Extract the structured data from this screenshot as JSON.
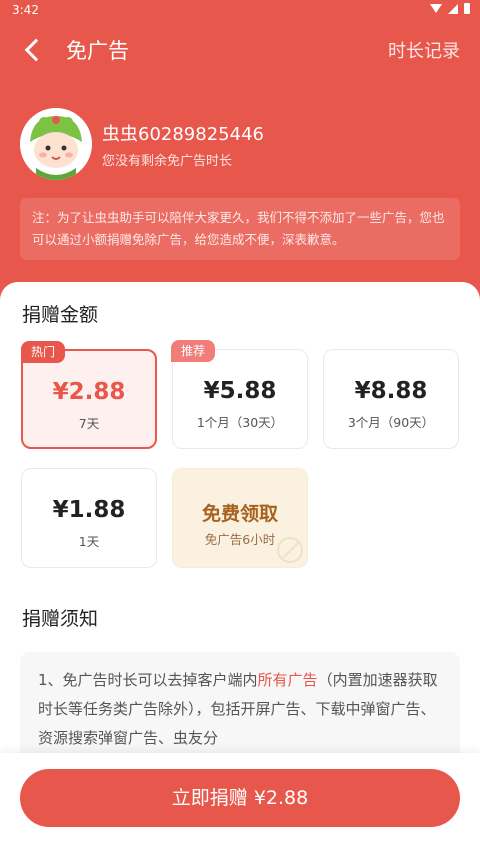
{
  "status_bar": {
    "time": "3:42",
    "icons": [
      "wifi-icon",
      "signal-icon",
      "battery-icon"
    ]
  },
  "header": {
    "back_icon": "chevron-left-icon",
    "title": "免广告",
    "record_link": "时长记录"
  },
  "user": {
    "name": "虫虫60289825446",
    "remaining_text": "您没有剩余免广告时长"
  },
  "notice": "注：为了让虫虫助手可以陪伴大家更久，我们不得不添加了一些广告，您也可以通过小额捐赠免除广告，给您造成不便，深表歉意。",
  "donation": {
    "section_title": "捐赠金额",
    "options": [
      {
        "badge": "热门",
        "price": "¥2.88",
        "duration": "7天",
        "selected": true
      },
      {
        "badge": "推荐",
        "price": "¥5.88",
        "duration": "1个月（30天）",
        "selected": false
      },
      {
        "badge": "",
        "price": "¥8.88",
        "duration": "3个月（90天）",
        "selected": false
      },
      {
        "badge": "",
        "price": "¥1.88",
        "duration": "1天",
        "selected": false
      },
      {
        "badge": "",
        "price": "免费领取",
        "duration": "免广告6小时",
        "selected": false,
        "free": true
      }
    ]
  },
  "tips": {
    "section_title": "捐赠须知",
    "text_before": "1、免广告时长可以去掉客户端内",
    "highlight": "所有广告",
    "text_after": "（内置加速器获取时长等任务类广告除外），包括开屏广告、下载中弹窗广告、资源搜索弹窗广告、虫友分"
  },
  "footer": {
    "button_label": "立即捐赠 ¥2.88"
  },
  "colors": {
    "primary": "#e8574b",
    "free_bg": "#fbf1e1",
    "free_text": "#a8621e"
  }
}
